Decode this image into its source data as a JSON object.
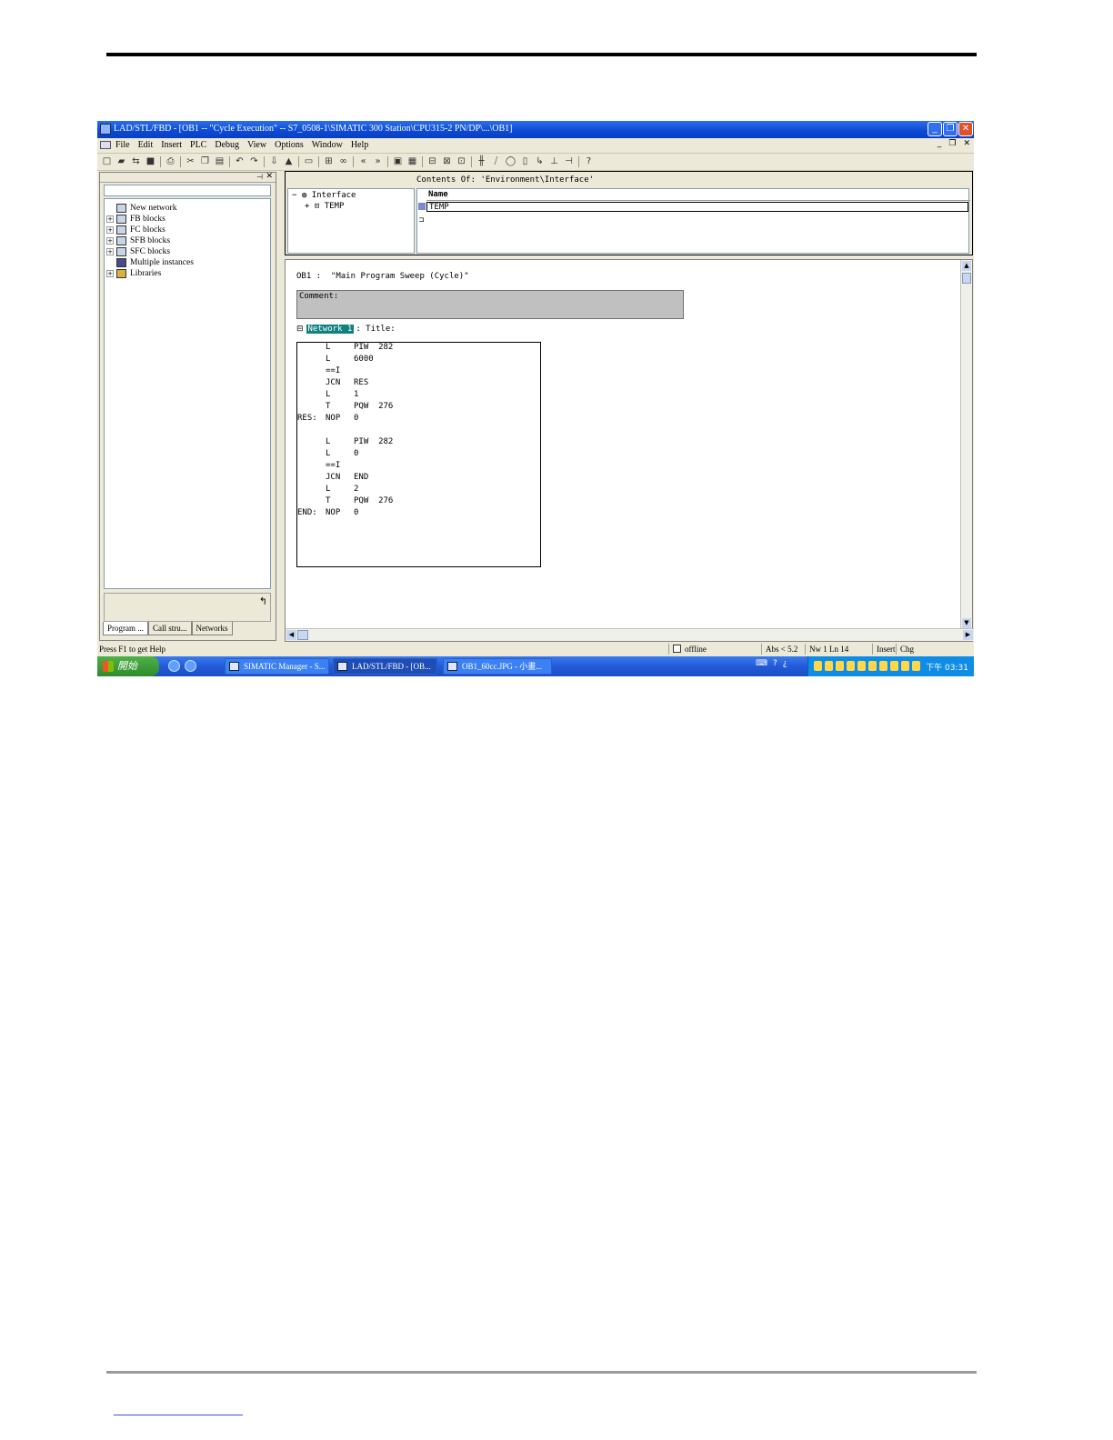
{
  "window": {
    "title": "LAD/STL/FBD  - [OB1 -- \"Cycle Execution\" -- S7_0508-1\\SIMATIC 300 Station\\CPU315-2 PN/DP\\...\\OB1]",
    "minimize_glyph": "_",
    "restore_glyph": "❐",
    "close_glyph": "✕"
  },
  "menu": {
    "items": [
      "File",
      "Edit",
      "Insert",
      "PLC",
      "Debug",
      "View",
      "Options",
      "Window",
      "Help"
    ],
    "mdi_min": "_",
    "mdi_restore": "❐",
    "mdi_close": "✕"
  },
  "toolbar_icons": [
    "new-icon",
    "open-icon",
    "accessible-nodes-icon",
    "save-icon",
    "print-icon",
    "cut-icon",
    "copy-icon",
    "paste-icon",
    "undo-icon",
    "redo-icon",
    "download-icon",
    "upload-icon",
    "display-icon",
    "monitor-icon",
    "first-icon",
    "last-icon",
    "overview-icon",
    "details-icon",
    "new-network-icon",
    "insert-icon",
    "insert-icon-2",
    "contact-no-icon",
    "contact-nc-icon",
    "coil-icon",
    "box-icon",
    "branch-open-icon",
    "branch-close-icon",
    "connection-icon",
    "help-context-icon"
  ],
  "left_pane": {
    "pin_glyph": "⊣",
    "close_glyph": "✕",
    "tree": [
      {
        "label": "New network",
        "expander": ""
      },
      {
        "label": "FB blocks",
        "expander": "+"
      },
      {
        "label": "FC blocks",
        "expander": "+"
      },
      {
        "label": "SFB blocks",
        "expander": "+"
      },
      {
        "label": "SFC blocks",
        "expander": "+"
      },
      {
        "label": "Multiple instances",
        "expander": ""
      },
      {
        "label": "Libraries",
        "expander": "+"
      }
    ],
    "context_glyph": "↰",
    "tabs": [
      "Program ...",
      "Call stru...",
      "Networks"
    ]
  },
  "interface": {
    "root": "Interface",
    "root_expander": "−",
    "child": "TEMP",
    "child_expander": "+",
    "contents_label": "Contents Of: 'Environment\\Interface'",
    "column_name": "Name",
    "row_name": "TEMP"
  },
  "editor": {
    "block_title": "OB1 :  \"Main Program Sweep (Cycle)\"",
    "comment_label": "Comment:",
    "network_toggle": "⊟",
    "network_label": "Network 1",
    "network_title": ": Title:",
    "code": [
      {
        "label": "",
        "op": "L",
        "arg": "PIW  282"
      },
      {
        "label": "",
        "op": "L",
        "arg": "6000"
      },
      {
        "label": "",
        "op": "==I",
        "arg": ""
      },
      {
        "label": "",
        "op": "JCN",
        "arg": "RES"
      },
      {
        "label": "",
        "op": "L",
        "arg": "1"
      },
      {
        "label": "",
        "op": "T",
        "arg": "PQW  276"
      },
      {
        "label": "RES:",
        "op": "NOP",
        "arg": "0"
      },
      {
        "label": "",
        "op": "",
        "arg": ""
      },
      {
        "label": "",
        "op": "L",
        "arg": "PIW  282"
      },
      {
        "label": "",
        "op": "L",
        "arg": "0"
      },
      {
        "label": "",
        "op": "==I",
        "arg": ""
      },
      {
        "label": "",
        "op": "JCN",
        "arg": "END"
      },
      {
        "label": "",
        "op": "L",
        "arg": "2"
      },
      {
        "label": "",
        "op": "T",
        "arg": "PQW  276"
      },
      {
        "label": "END:",
        "op": "NOP",
        "arg": "0"
      }
    ]
  },
  "status": {
    "help": "Press F1 to get Help",
    "mode": "offline",
    "abs": "Abs < 5.2",
    "position": "Nw 1   Ln 14",
    "insert": "Insert",
    "chg": "Chg"
  },
  "taskbar": {
    "start_label": "開始",
    "tasks": [
      {
        "label": "SIMATIC Manager - S...",
        "active": false
      },
      {
        "label": "LAD/STL/FBD  - [OB...",
        "active": true
      },
      {
        "label": "OB1_60cc.JPG - 小畫...",
        "active": false
      }
    ],
    "lang_glyphs": [
      "⌨",
      "?",
      "¿"
    ],
    "clock": "下午 03:31"
  }
}
